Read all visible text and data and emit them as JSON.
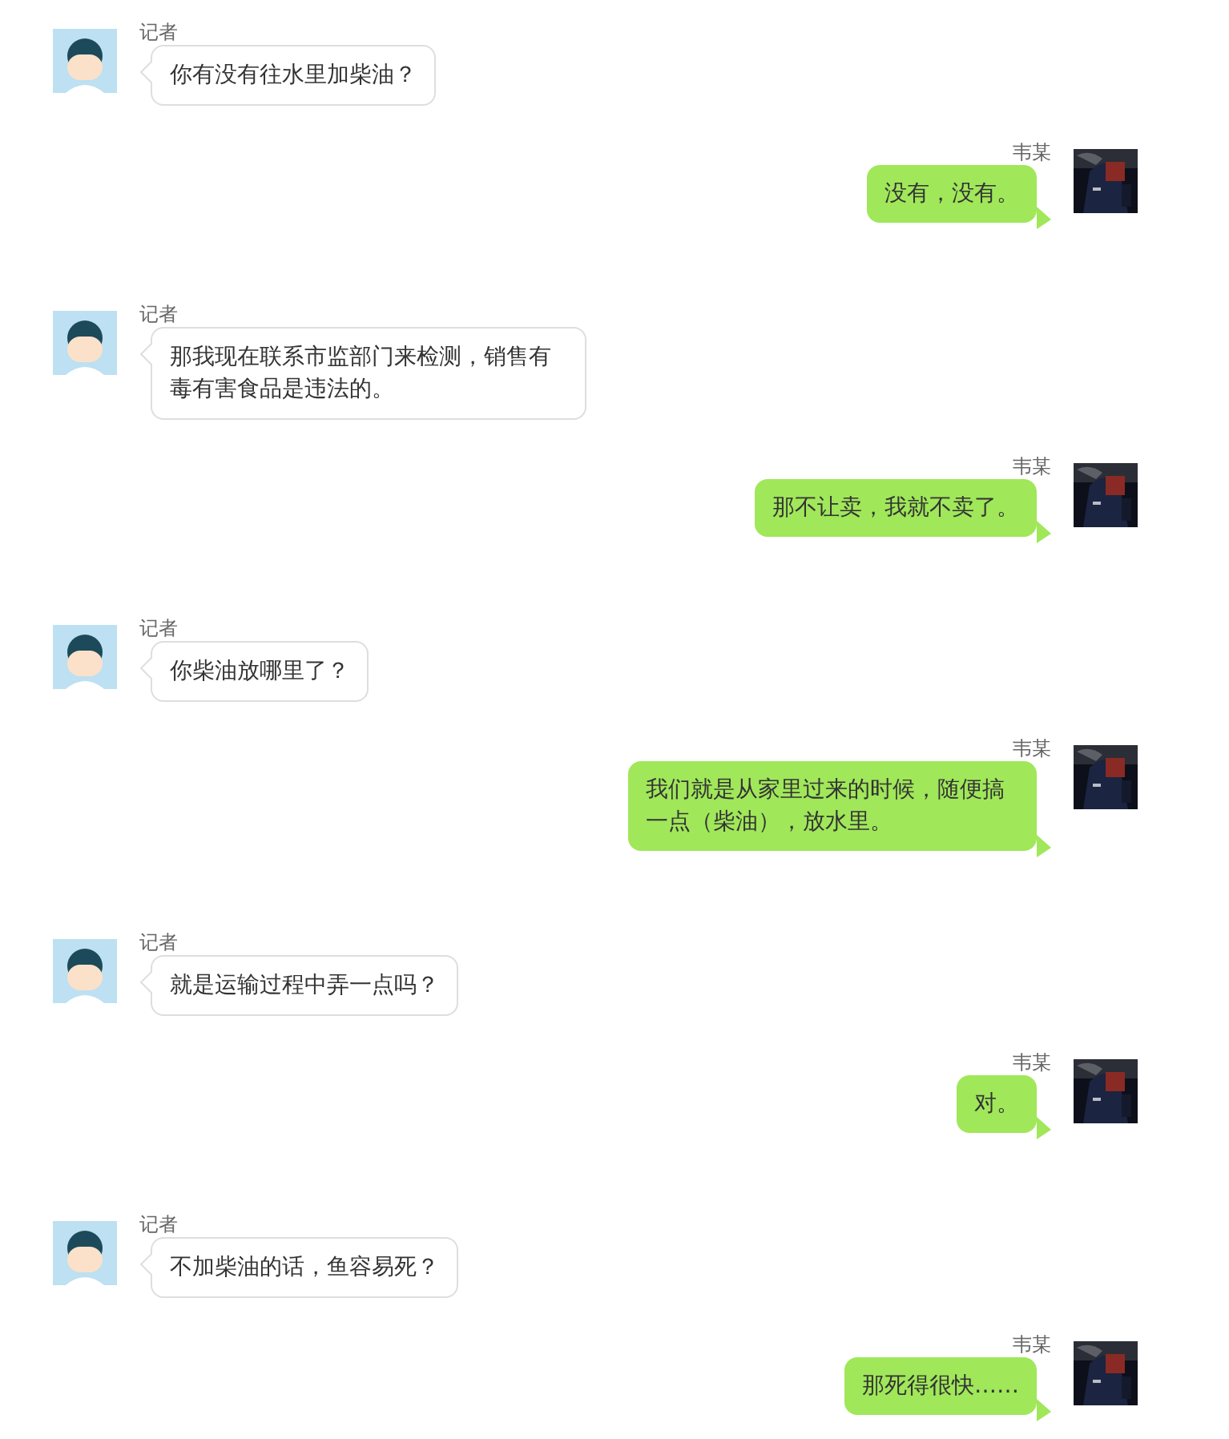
{
  "messages": [
    {
      "kind": "incoming",
      "sender": "记者",
      "text": "你有没有往水里加柴油？"
    },
    {
      "kind": "outgoing",
      "sender": "韦某",
      "text": "没有，没有。"
    },
    {
      "kind": "incoming",
      "sender": "记者",
      "text": "那我现在联系市监部门来检测，销售有毒有害食品是违法的。"
    },
    {
      "kind": "outgoing",
      "sender": "韦某",
      "text": "那不让卖，我就不卖了。"
    },
    {
      "kind": "incoming",
      "sender": "记者",
      "text": "你柴油放哪里了？"
    },
    {
      "kind": "outgoing",
      "sender": "韦某",
      "text": "我们就是从家里过来的时候，随便搞一点（柴油），放水里。"
    },
    {
      "kind": "incoming",
      "sender": "记者",
      "text": "就是运输过程中弄一点吗？"
    },
    {
      "kind": "outgoing",
      "sender": "韦某",
      "text": "对。"
    },
    {
      "kind": "incoming",
      "sender": "记者",
      "text": "不加柴油的话，鱼容易死？"
    },
    {
      "kind": "outgoing",
      "sender": "韦某",
      "text": "那死得很快……"
    }
  ]
}
